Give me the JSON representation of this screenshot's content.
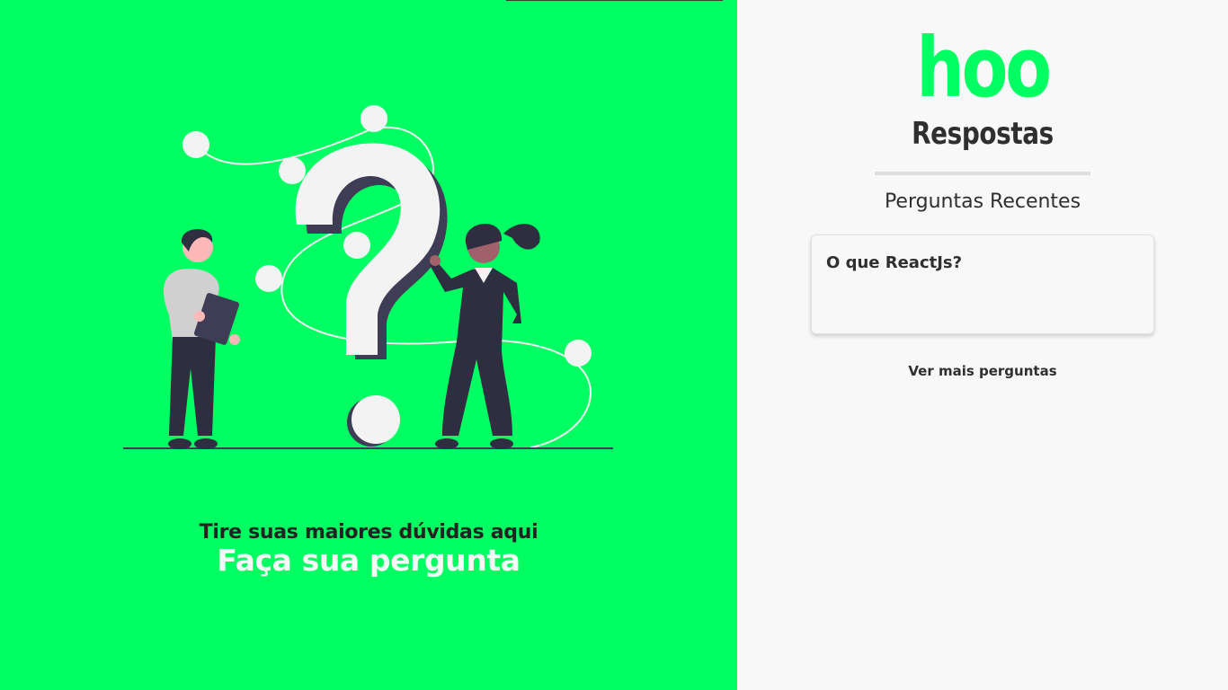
{
  "hero": {
    "tagline_top": "Tire suas maiores dúvidas aqui",
    "tagline_cta": "Faça sua pergunta",
    "illustration_icon": "question-people-illustration"
  },
  "brand": {
    "name": "hoo",
    "subtitle": "Respostas"
  },
  "recent": {
    "title": "Perguntas Recentes",
    "questions": [
      {
        "title": "O que ReactJs?"
      }
    ],
    "more_label": "Ver mais perguntas"
  },
  "colors": {
    "accent_green": "#00ff62",
    "text_dark": "#2f2f2f",
    "panel_bg": "#f8f8f8"
  }
}
